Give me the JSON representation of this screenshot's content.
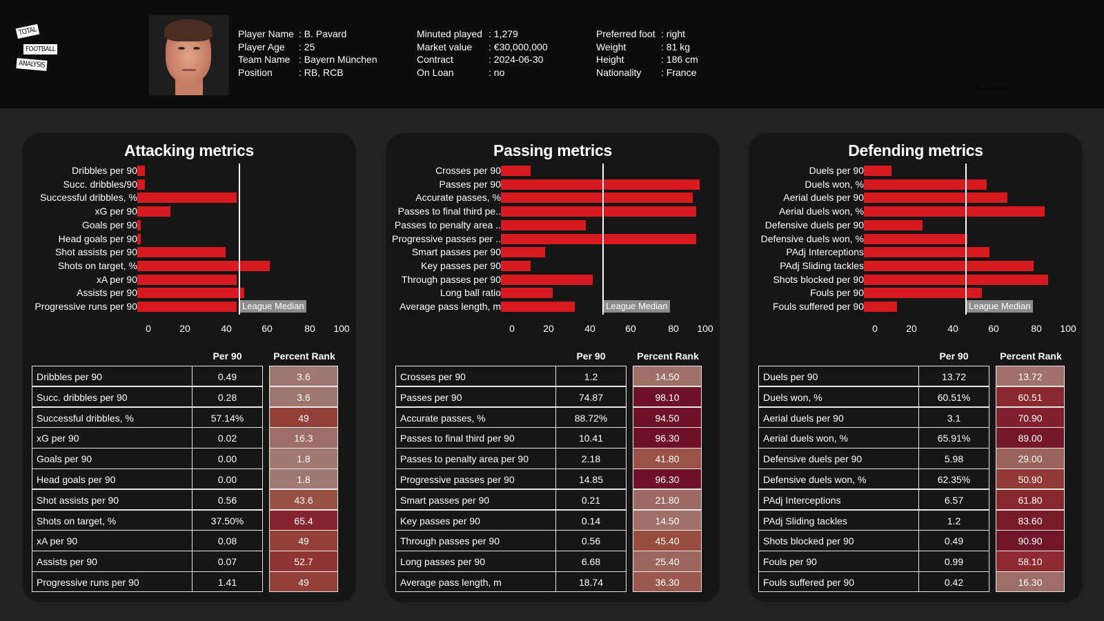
{
  "logo": {
    "line1": "TOTAL",
    "line2": "FOOTBALL",
    "line3": "ANALYSIS"
  },
  "player": {
    "col1": [
      {
        "key": "Player Name",
        "value": ": B. Pavard"
      },
      {
        "key": "Player Age",
        "value": ": 25"
      },
      {
        "key": "Team Name",
        "value": ": Bayern München"
      },
      {
        "key": "Position",
        "value": ": RB, RCB"
      }
    ],
    "col2": [
      {
        "key": "Minuted played",
        "value": ": 1,279"
      },
      {
        "key": "Market value",
        "value": ": €30,000,000"
      },
      {
        "key": "Contract",
        "value": ": 2024-06-30"
      },
      {
        "key": "On Loan",
        "value": ": no"
      }
    ],
    "col3": [
      {
        "key": "Preferred foot",
        "value": ": right"
      },
      {
        "key": "Weight",
        "value": ": 81 kg"
      },
      {
        "key": "Height",
        "value": ": 186 cm"
      },
      {
        "key": "Nationality",
        "value": ": France"
      }
    ],
    "ghost_name": "B. Pavard"
  },
  "colors": {
    "bar": "#d71920",
    "median_line": "#ffffff",
    "median_label_bg": "#8c8c8c"
  },
  "table_headers": {
    "per90": "Per 90",
    "rank": "Percent Rank"
  },
  "chart_data": [
    {
      "type": "bar",
      "title": "Attacking metrics",
      "orientation": "horizontal",
      "xlim": [
        0,
        100
      ],
      "xticks": [
        "0",
        "20",
        "40",
        "60",
        "80",
        "100"
      ],
      "median": 50,
      "median_label": "League Median",
      "categories": [
        "Dribbles per 90",
        "Succ. dribbles/90",
        "Successful dribbles, %",
        "xG per 90",
        "Goals per 90",
        "Head goals per 90",
        "Shot assists per 90",
        "Shots on target, %",
        "xA per 90",
        "Assists per 90",
        "Progressive runs per 90"
      ],
      "values": [
        3.6,
        3.6,
        49,
        16.3,
        1.8,
        1.8,
        43.6,
        65.4,
        49,
        52.7,
        49
      ],
      "table": [
        {
          "metric": "Dribbles per 90",
          "per90": "0.49",
          "rank": "3.6"
        },
        {
          "metric": "Succ. dribbles per 90",
          "per90": "0.28",
          "rank": "3.6"
        },
        {
          "metric": "Successful dribbles, %",
          "per90": "57.14%",
          "rank": "49"
        },
        {
          "metric": "xG per 90",
          "per90": "0.02",
          "rank": "16.3"
        },
        {
          "metric": "Goals per 90",
          "per90": "0.00",
          "rank": "1.8"
        },
        {
          "metric": "Head goals per 90",
          "per90": "0.00",
          "rank": "1.8"
        },
        {
          "metric": "Shot assists per 90",
          "per90": "0.56",
          "rank": "43.6"
        },
        {
          "metric": "Shots on target, %",
          "per90": "37.50%",
          "rank": "65.4"
        },
        {
          "metric": "xA per 90",
          "per90": "0.08",
          "rank": "49"
        },
        {
          "metric": "Assists per 90",
          "per90": "0.07",
          "rank": "52.7"
        },
        {
          "metric": "Progressive runs per 90",
          "per90": "1.41",
          "rank": "49"
        }
      ]
    },
    {
      "type": "bar",
      "title": "Passing metrics",
      "orientation": "horizontal",
      "xlim": [
        0,
        100
      ],
      "xticks": [
        "0",
        "20",
        "40",
        "60",
        "80",
        "100"
      ],
      "median": 50,
      "median_label": "League Median",
      "categories": [
        "Crosses per 90",
        "Passes per 90",
        "Accurate passes, %",
        "Passes to final third pe..",
        "Passes to penalty area ..",
        "Progressive passes per ..",
        "Smart passes per 90",
        "Key passes per 90",
        "Through passes per 90",
        "Long ball ratio",
        "Average pass length, m"
      ],
      "values": [
        14.5,
        98.1,
        94.5,
        96.3,
        41.8,
        96.3,
        21.8,
        14.5,
        45.4,
        25.4,
        36.3
      ],
      "table": [
        {
          "metric": "Crosses per 90",
          "per90": "1.2",
          "rank": "14.50"
        },
        {
          "metric": "Passes per 90",
          "per90": "74.87",
          "rank": "98.10"
        },
        {
          "metric": "Accurate passes, %",
          "per90": "88.72%",
          "rank": "94.50"
        },
        {
          "metric": "Passes to final third per 90",
          "per90": "10.41",
          "rank": "96.30"
        },
        {
          "metric": "Passes to penalty area per 90",
          "per90": "2.18",
          "rank": "41.80"
        },
        {
          "metric": "Progressive passes per 90",
          "per90": "14.85",
          "rank": "96.30"
        },
        {
          "metric": "Smart passes per 90",
          "per90": "0.21",
          "rank": "21.80"
        },
        {
          "metric": "Key passes per 90",
          "per90": "0.14",
          "rank": "14.50"
        },
        {
          "metric": "Through passes per 90",
          "per90": "0.56",
          "rank": "45.40"
        },
        {
          "metric": "Long passes per 90",
          "per90": "6.68",
          "rank": "25.40"
        },
        {
          "metric": "Average pass length, m",
          "per90": "18.74",
          "rank": "36.30"
        }
      ]
    },
    {
      "type": "bar",
      "title": "Defending metrics",
      "orientation": "horizontal",
      "xlim": [
        0,
        100
      ],
      "xticks": [
        "0",
        "20",
        "40",
        "60",
        "80",
        "100"
      ],
      "median": 50,
      "median_label": "League Median",
      "categories": [
        "Duels per 90",
        "Duels won, %",
        "Aerial duels per 90",
        "Aerial duels won, %",
        "Defensive duels per 90",
        "Defensive duels won, %",
        "PAdj Interceptions",
        "PAdj Sliding tackles",
        "Shots blocked per 90",
        "Fouls per 90",
        "Fouls suffered per 90"
      ],
      "values": [
        13.72,
        60.51,
        70.9,
        89.0,
        29.0,
        50.9,
        61.8,
        83.6,
        90.9,
        58.1,
        16.3
      ],
      "table": [
        {
          "metric": "Duels per 90",
          "per90": "13.72",
          "rank": "13.72"
        },
        {
          "metric": "Duels won, %",
          "per90": "60.51%",
          "rank": "60.51"
        },
        {
          "metric": "Aerial duels per 90",
          "per90": "3.1",
          "rank": "70.90"
        },
        {
          "metric": "Aerial duels won, %",
          "per90": "65.91%",
          "rank": "89.00"
        },
        {
          "metric": "Defensive duels per 90",
          "per90": "5.98",
          "rank": "29.00"
        },
        {
          "metric": "Defensive duels won, %",
          "per90": "62.35%",
          "rank": "50.90"
        },
        {
          "metric": "PAdj Interceptions",
          "per90": "6.57",
          "rank": "61.80"
        },
        {
          "metric": "PAdj Sliding tackles",
          "per90": "1.2",
          "rank": "83.60"
        },
        {
          "metric": "Shots blocked per 90",
          "per90": "0.49",
          "rank": "90.90"
        },
        {
          "metric": "Fouls per 90",
          "per90": "0.99",
          "rank": "58.10"
        },
        {
          "metric": "Fouls suffered per 90",
          "per90": "0.42",
          "rank": "16.30"
        }
      ]
    }
  ]
}
